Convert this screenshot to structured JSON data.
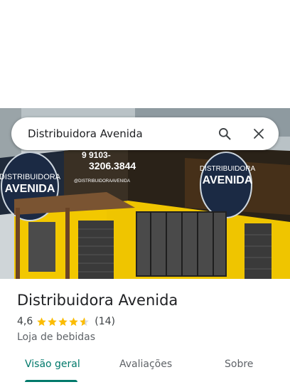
{
  "search": {
    "query": "Distribuidora Avenida"
  },
  "photo": {
    "sign_left_line1": "DISTRIBUIDORA",
    "sign_left_line2": "AVENIDA",
    "sign_right_line1": "DISTRIBUIDORA",
    "sign_right_line2": "AVENIDA",
    "phone_1": "9 9103-",
    "phone_2": "3206.3844",
    "social": "@DISTRIBUIDORAAVENIDA"
  },
  "place": {
    "name": "Distribuidora Avenida",
    "rating": "4,6",
    "stars": 4.6,
    "review_count": "(14)",
    "category": "Loja de bebidas"
  },
  "tabs": [
    {
      "label": "Visão geral",
      "active": true
    },
    {
      "label": "Avaliações",
      "active": false
    },
    {
      "label": "Sobre",
      "active": false
    }
  ],
  "colors": {
    "accent": "#00796b",
    "star": "#fbbc04",
    "wall": "#f2c800"
  }
}
